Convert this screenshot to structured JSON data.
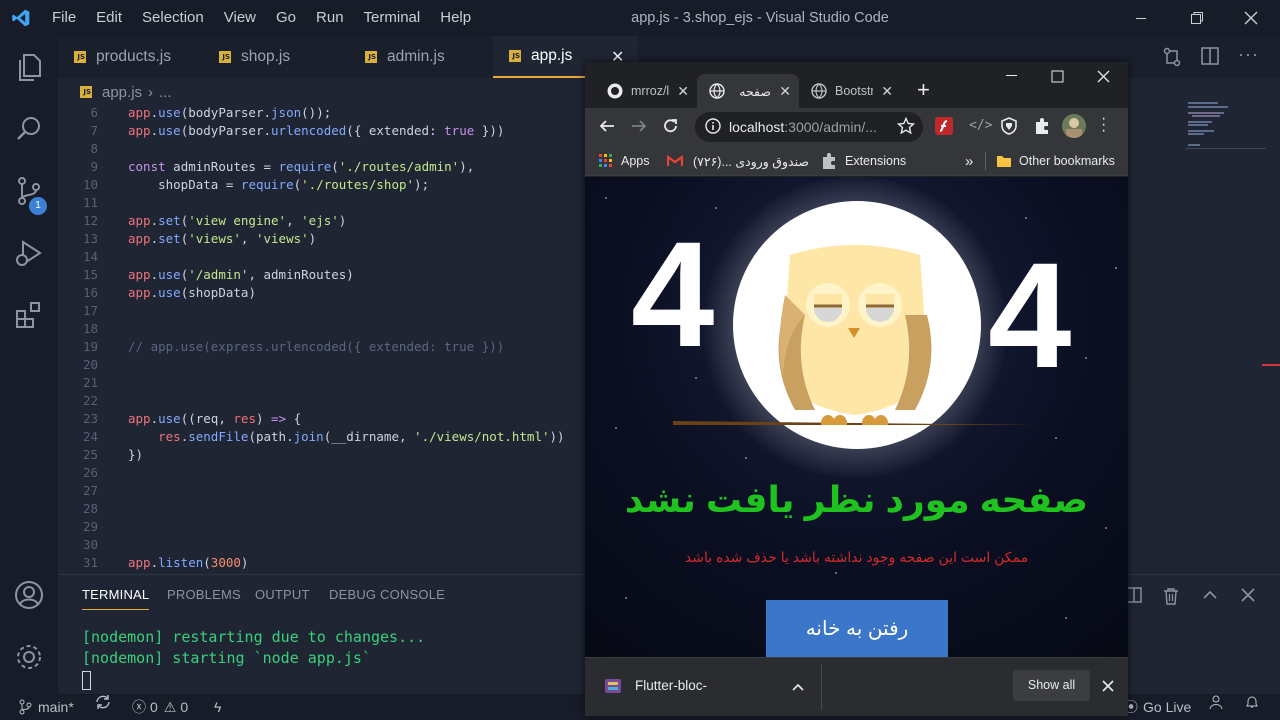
{
  "titlebar": {
    "menu": [
      "File",
      "Edit",
      "Selection",
      "View",
      "Go",
      "Run",
      "Terminal",
      "Help"
    ],
    "window_title": "app.js - 3.shop_ejs - Visual Studio Code"
  },
  "activitybar": {
    "icons": [
      "explorer-icon",
      "search-icon",
      "source-control-icon",
      "run-debug-icon",
      "extensions-icon",
      "account-icon",
      "settings-gear-icon"
    ],
    "scm_badge": "1"
  },
  "tabs": [
    {
      "label": "products.js",
      "active": false
    },
    {
      "label": "shop.js",
      "active": false
    },
    {
      "label": "admin.js",
      "active": false
    },
    {
      "label": "app.js",
      "active": true
    }
  ],
  "breadcrumb": {
    "file": "app.js",
    "rest": "..."
  },
  "editor": {
    "lines": [
      {
        "n": "6",
        "text": "app.use(bodyParser.json());"
      },
      {
        "n": "7",
        "text": "app.use(bodyParser.urlencoded({ extended: true }))"
      },
      {
        "n": "8",
        "text": ""
      },
      {
        "n": "9",
        "text": "const adminRoutes = require('./routes/admin'),"
      },
      {
        "n": "10",
        "text": "    shopData = require('./routes/shop');"
      },
      {
        "n": "11",
        "text": ""
      },
      {
        "n": "12",
        "text": "app.set('view engine', 'ejs')"
      },
      {
        "n": "13",
        "text": "app.set('views', 'views')"
      },
      {
        "n": "14",
        "text": ""
      },
      {
        "n": "15",
        "text": "app.use('/admin', adminRoutes)"
      },
      {
        "n": "16",
        "text": "app.use(shopData)"
      },
      {
        "n": "17",
        "text": ""
      },
      {
        "n": "18",
        "text": ""
      },
      {
        "n": "19",
        "text": "// app.use(express.urlencoded({ extended: true }))"
      },
      {
        "n": "20",
        "text": ""
      },
      {
        "n": "21",
        "text": ""
      },
      {
        "n": "22",
        "text": ""
      },
      {
        "n": "23",
        "text": "app.use((req, res) => {"
      },
      {
        "n": "24",
        "text": "    res.sendFile(path.join(__dirname, './views/not.html'))"
      },
      {
        "n": "25",
        "text": "})"
      },
      {
        "n": "26",
        "text": ""
      },
      {
        "n": "27",
        "text": ""
      },
      {
        "n": "28",
        "text": ""
      },
      {
        "n": "29",
        "text": ""
      },
      {
        "n": "30",
        "text": ""
      },
      {
        "n": "31",
        "text": "app.listen(3000)"
      }
    ]
  },
  "panel": {
    "tabs": [
      "TERMINAL",
      "PROBLEMS",
      "OUTPUT",
      "DEBUG CONSOLE"
    ],
    "active_tab": "TERMINAL",
    "terminal_lines": [
      "[nodemon] restarting due to changes...",
      "[nodemon] starting `node app.js`"
    ]
  },
  "statusbar": {
    "branch": "main*",
    "errors": "0",
    "warnings": "0",
    "go_live": "Go Live"
  },
  "chrome": {
    "tabs": [
      {
        "title": "mrroz/l",
        "icon": "github-icon",
        "active": false
      },
      {
        "title": "صفحه",
        "icon": "globe-icon",
        "active": true
      },
      {
        "title": "Bootstr",
        "icon": "globe-icon",
        "active": false
      }
    ],
    "url_host": "localhost",
    "url_rest": ":3000/admin/...",
    "bookmarks": {
      "apps": "Apps",
      "gmail": "(۷۲۶)... صندوق ورودی",
      "extensions": "Extensions",
      "overflow": "»",
      "other": "Other bookmarks"
    }
  },
  "page": {
    "left_digit": "4",
    "right_digit": "4",
    "heading": "صفحه مورد نظر یافت نشد",
    "subtitle": "ممکن است این صفحه وجود نداشته باشد یا حذف شده باشد",
    "home_button": "رفتن به خانه"
  },
  "downloads": {
    "file": "Flutter-bloc-",
    "show_all": "Show all"
  },
  "colors": {
    "accent_tab_border": "#e8a93a",
    "heading_green": "#1fc21f",
    "subtitle_red": "#d22a2a",
    "button_blue": "#3b76c9",
    "terminal_green": "#39d07a"
  }
}
